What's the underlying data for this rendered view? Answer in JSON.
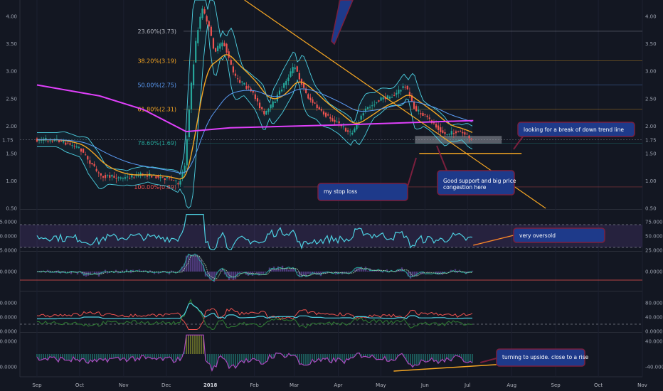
{
  "chart_data": {
    "type": "line",
    "panes": {
      "price": {
        "ylim": [
          0.5,
          4.3
        ],
        "yticks": [
          "0.50",
          "1.00",
          "1.50",
          "2.00",
          "2.50",
          "3.00",
          "3.50",
          "4.00"
        ],
        "last_price": "1.75",
        "fib_levels": [
          {
            "label": "23.60%(3.73)",
            "value": 3.73,
            "color": "#b2b5be"
          },
          {
            "label": "38.20%(3.19)",
            "value": 3.19,
            "color": "#f5a623"
          },
          {
            "label": "50.00%(2.75)",
            "value": 2.75,
            "color": "#5b9cf6"
          },
          {
            "label": "61.80%(2.31)",
            "value": 2.31,
            "color": "#f5a623"
          },
          {
            "label": "78.60%(1.69)",
            "value": 1.69,
            "color": "#26a69a"
          },
          {
            "label": "100.00%(0.89)",
            "value": 0.89,
            "color": "#ef5350"
          }
        ],
        "close_path": [
          [
            "2017-09-01",
            1.75
          ],
          [
            "2017-09-15",
            1.75
          ],
          [
            "2017-10-01",
            1.6
          ],
          [
            "2017-10-15",
            1.1
          ],
          [
            "2017-11-01",
            1.05
          ],
          [
            "2017-11-15",
            1.12
          ],
          [
            "2017-12-01",
            1.05
          ],
          [
            "2017-12-10",
            0.95
          ],
          [
            "2017-12-14",
            1.3
          ],
          [
            "2017-12-18",
            2.6
          ],
          [
            "2017-12-22",
            3.6
          ],
          [
            "2017-12-26",
            4.15
          ],
          [
            "2017-12-30",
            3.9
          ],
          [
            "2018-01-04",
            3.35
          ],
          [
            "2018-01-10",
            3.55
          ],
          [
            "2018-01-18",
            2.9
          ],
          [
            "2018-01-25",
            2.75
          ],
          [
            "2018-02-01",
            2.55
          ],
          [
            "2018-02-08",
            2.2
          ],
          [
            "2018-02-15",
            2.45
          ],
          [
            "2018-03-01",
            3.1
          ],
          [
            "2018-03-10",
            2.55
          ],
          [
            "2018-03-20",
            2.25
          ],
          [
            "2018-04-01",
            2.05
          ],
          [
            "2018-04-10",
            1.85
          ],
          [
            "2018-04-20",
            2.3
          ],
          [
            "2018-05-01",
            2.5
          ],
          [
            "2018-05-10",
            2.55
          ],
          [
            "2018-05-18",
            2.75
          ],
          [
            "2018-05-25",
            2.3
          ],
          [
            "2018-06-05",
            2.1
          ],
          [
            "2018-06-15",
            1.85
          ],
          [
            "2018-06-25",
            1.9
          ],
          [
            "2018-07-05",
            1.75
          ]
        ],
        "down_trend_line": [
          [
            "2018-01-25",
            4.3
          ],
          [
            "2018-08-25",
            0.5
          ]
        ],
        "ma_200": [
          [
            "2017-09-01",
            2.75
          ],
          [
            "2017-10-15",
            2.55
          ],
          [
            "2017-11-15",
            2.3
          ],
          [
            "2017-12-15",
            1.9
          ],
          [
            "2018-01-15",
            1.97
          ],
          [
            "2018-04-01",
            2.02
          ],
          [
            "2018-07-05",
            2.1
          ]
        ],
        "stop_loss_level": 1.5,
        "support_zone": [
          1.68,
          1.82
        ]
      },
      "rsi": {
        "ylim": [
          25,
          95
        ],
        "yticks": [
          "25.0000",
          "50.0000",
          "75.0000"
        ],
        "levels": [
          70,
          30
        ]
      },
      "macd": {
        "yticks": [
          "0.0000"
        ]
      },
      "dmi": {
        "ylim": [
          0,
          110
        ],
        "yticks": [
          "0.0000",
          "40.0000",
          "80.0000"
        ],
        "level": 20
      },
      "osc": {
        "ylim": [
          -65,
          65
        ],
        "yticks": [
          "-40.0000",
          "40.0000"
        ]
      }
    },
    "x_axis": {
      "labels": [
        "Sep",
        "Oct",
        "Nov",
        "Dec",
        "2018",
        "Feb",
        "Mar",
        "Apr",
        "May",
        "Jun",
        "Jul",
        "Aug",
        "Sep",
        "Oct",
        "Nov"
      ]
    }
  },
  "annotations": {
    "break_trend": "looking for a break of down trend line",
    "stop_loss": "my stop loss",
    "support_1": "Good support and big price",
    "support_2": "congestion here",
    "oversold": "very oversold",
    "upside": "turning to upside. close to a rise"
  }
}
